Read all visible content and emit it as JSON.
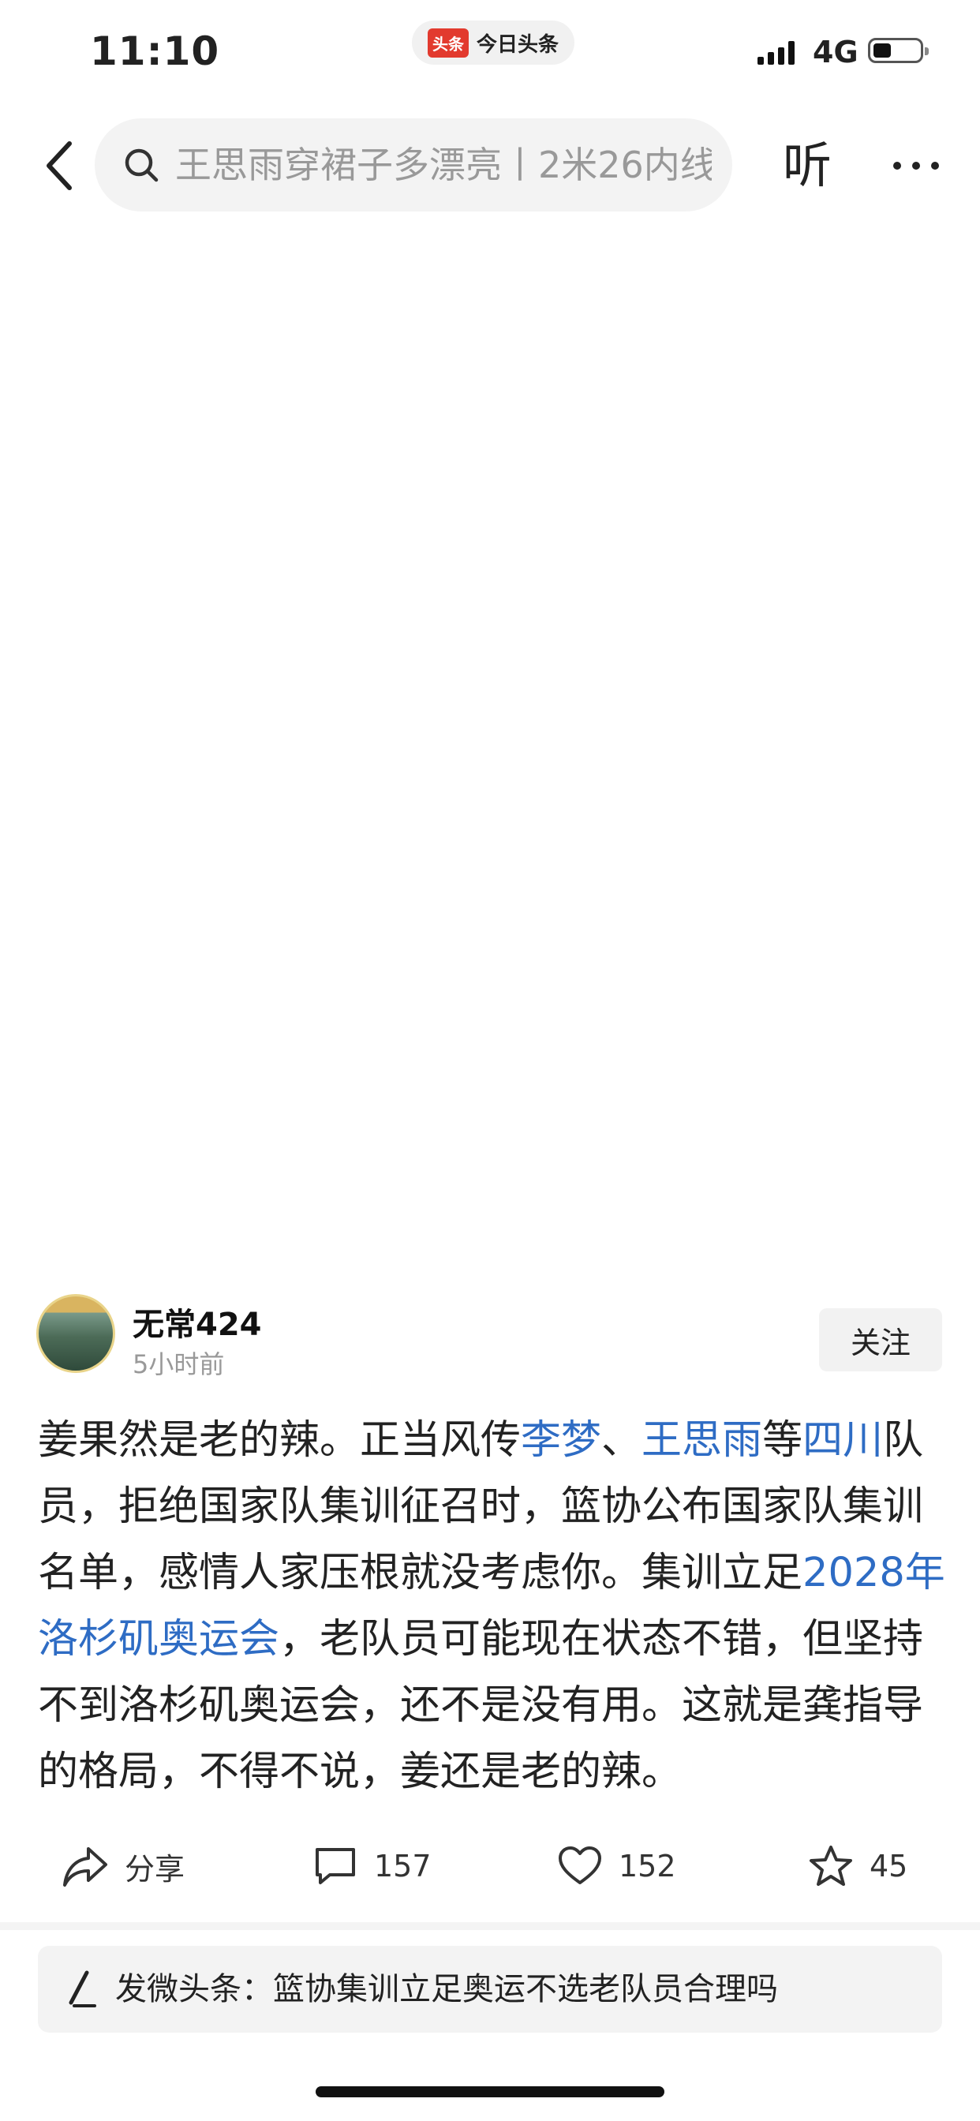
{
  "status_bar": {
    "time": "11:10",
    "app_badge": "头条",
    "app_name": "今日头条",
    "network": "4G",
    "battery_level": 0.4
  },
  "nav": {
    "back_icon": "chevron-left-icon",
    "search_placeholder": "王思雨穿裙子多漂亮丨2米26内线",
    "listen_label": "听",
    "more_icon": "more-dots-icon"
  },
  "author": {
    "name": "无常424",
    "time": "5小时前",
    "follow_label": "关注"
  },
  "post": {
    "segments": [
      {
        "text": "姜果然是老的辣。正当风传",
        "link": false
      },
      {
        "text": "李梦",
        "link": true
      },
      {
        "text": "、",
        "link": false
      },
      {
        "text": "王思雨",
        "link": true
      },
      {
        "text": "等",
        "link": false
      },
      {
        "text": "四川",
        "link": true
      },
      {
        "text": "队员，拒绝国家队集训征召时，篮协公布国家队集训名单，感情人家压根就没考虑你。集训立足",
        "link": false
      },
      {
        "text": "2028年洛杉矶奥运会",
        "link": true
      },
      {
        "text": "，老队员可能现在状态不错，但坚持不到洛杉矶奥运会，还不是没有用。这就是龚指导的格局，不得不说，姜还是老的辣。",
        "link": false
      }
    ],
    "link_color": "#2e6cc4"
  },
  "actions": {
    "share_label": "分享",
    "comment_count": "157",
    "like_count": "152",
    "favorite_count": "45"
  },
  "publish": {
    "text": "发微头条：篮协集训立足奥运不选老队员合理吗"
  }
}
